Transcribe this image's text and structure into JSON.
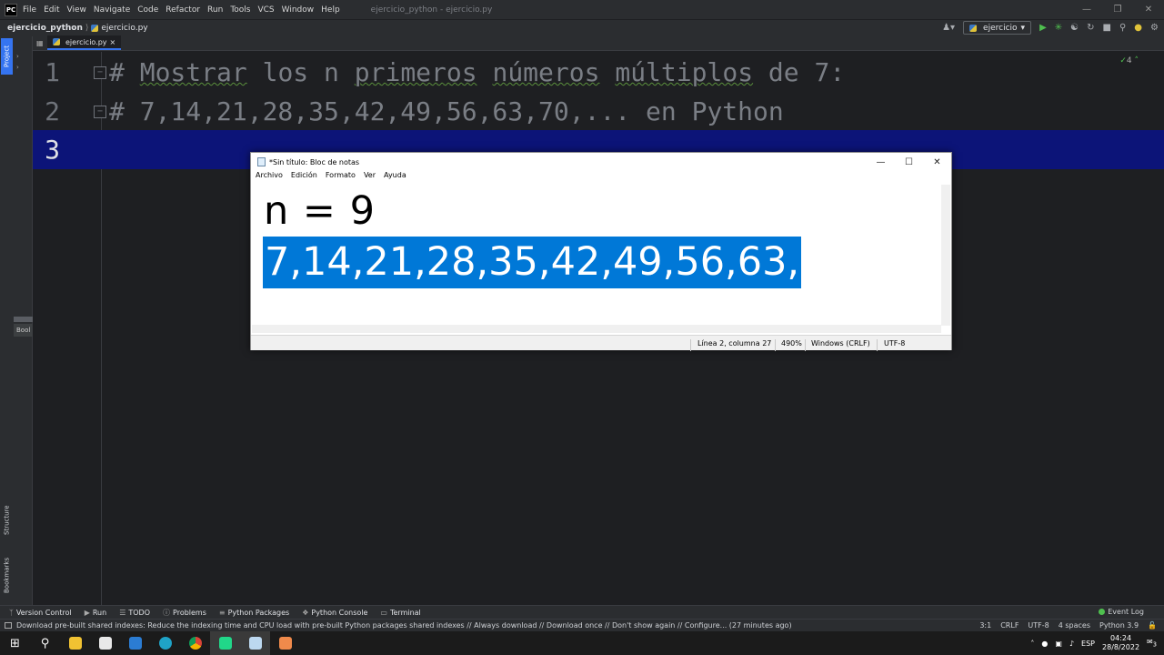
{
  "menubar": {
    "logo": "PC",
    "items": [
      "File",
      "Edit",
      "View",
      "Navigate",
      "Code",
      "Refactor",
      "Run",
      "Tools",
      "VCS",
      "Window",
      "Help"
    ],
    "window_title": "ejercicio_python - ejercicio.py"
  },
  "navbar": {
    "project": "ejercicio_python",
    "file": "ejercicio.py",
    "run_config": "ejercicio"
  },
  "left_strip": {
    "project_tab": "Project",
    "structure_tab": "Structure",
    "bookmarks_tab": "Bookmarks",
    "bookmarks_label": "Bool"
  },
  "tabs": [
    {
      "label": "ejercicio.py",
      "close": "×"
    }
  ],
  "editor": {
    "inspection_count": "4",
    "lines": [
      {
        "num": "1",
        "prefix": "# ",
        "words": [
          "Mostrar",
          "los",
          "n",
          "primeros",
          "números",
          "múltiplos",
          "de",
          "7:"
        ]
      },
      {
        "num": "2",
        "text": "# 7,14,21,28,35,42,49,56,63,70,... en Python"
      },
      {
        "num": "3",
        "text": ""
      }
    ]
  },
  "notepad": {
    "title": "*Sin título: Bloc de notas",
    "menu": [
      "Archivo",
      "Edición",
      "Formato",
      "Ver",
      "Ayuda"
    ],
    "line1": "n = 9",
    "line2_selected": "7,14,21,28,35,42,49,56,63,",
    "status": {
      "position": "Línea 2, columna 27",
      "zoom": "490%",
      "eol": "Windows (CRLF)",
      "encoding": "UTF-8"
    }
  },
  "bottom_tools": [
    "Version Control",
    "Run",
    "TODO",
    "Problems",
    "Python Packages",
    "Python Console",
    "Terminal"
  ],
  "event_log": "Event Log",
  "statusbar": {
    "message": "Download pre-built shared indexes: Reduce the indexing time and CPU load with pre-built Python packages shared indexes // Always download // Download once // Don't show again // Configure... (27 minutes ago)",
    "caret": "3:1",
    "eol": "CRLF",
    "encoding": "UTF-8",
    "indent": "4 spaces",
    "interpreter": "Python 3.9"
  },
  "taskbar": {
    "lang": "ESP",
    "time": "04:24",
    "date": "28/8/2022",
    "notifications": "3"
  },
  "colors": {
    "accent": "#3574f0",
    "current_line": "#0c1478",
    "selection": "#0078d7",
    "comment": "#7a7e85"
  }
}
